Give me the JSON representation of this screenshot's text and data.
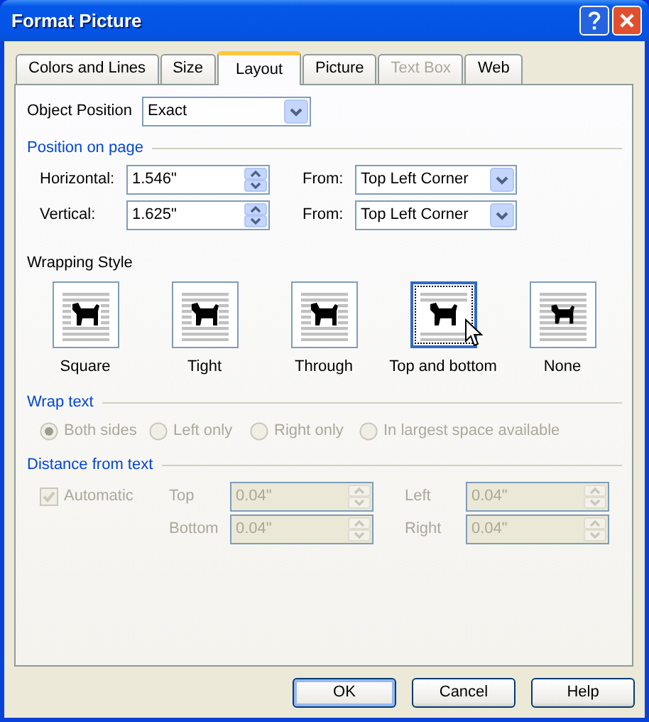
{
  "window": {
    "title": "Format Picture"
  },
  "tabs": [
    {
      "label": "Colors and Lines",
      "selected": false,
      "disabled": false
    },
    {
      "label": "Size",
      "selected": false,
      "disabled": false
    },
    {
      "label": "Layout",
      "selected": true,
      "disabled": false
    },
    {
      "label": "Picture",
      "selected": false,
      "disabled": false
    },
    {
      "label": "Text Box",
      "selected": false,
      "disabled": true
    },
    {
      "label": "Web",
      "selected": false,
      "disabled": false
    }
  ],
  "object_position": {
    "label": "Object Position",
    "value": "Exact"
  },
  "position_on_page": {
    "heading": "Position on page",
    "rows": [
      {
        "label": "Horizontal:",
        "value": "1.546\"",
        "from_label": "From:",
        "from_value": "Top Left Corner"
      },
      {
        "label": "Vertical:",
        "value": "1.625\"",
        "from_label": "From:",
        "from_value": "Top Left Corner"
      }
    ]
  },
  "wrapping_style": {
    "heading": "Wrapping Style",
    "options": [
      {
        "label": "Square",
        "kind": "square",
        "selected": false
      },
      {
        "label": "Tight",
        "kind": "tight",
        "selected": false
      },
      {
        "label": "Through",
        "kind": "through",
        "selected": false
      },
      {
        "label": "Top and bottom",
        "kind": "topbottom",
        "selected": true
      },
      {
        "label": "None",
        "kind": "none",
        "selected": false
      }
    ]
  },
  "wrap_text": {
    "heading": "Wrap text",
    "disabled": true,
    "options": [
      {
        "label": "Both sides",
        "selected": true
      },
      {
        "label": "Left only",
        "selected": false
      },
      {
        "label": "Right only",
        "selected": false
      },
      {
        "label": "In largest space available",
        "selected": false
      }
    ]
  },
  "distance_from_text": {
    "heading": "Distance from text",
    "disabled": true,
    "automatic": {
      "label": "Automatic",
      "checked": true
    },
    "fields": [
      {
        "label": "Top",
        "value": "0.04\""
      },
      {
        "label": "Left",
        "value": "0.04\""
      },
      {
        "label": "Bottom",
        "value": "0.04\""
      },
      {
        "label": "Right",
        "value": "0.04\""
      }
    ]
  },
  "buttons": [
    {
      "label": "OK",
      "default": true
    },
    {
      "label": "Cancel",
      "default": false
    },
    {
      "label": "Help",
      "default": false
    }
  ]
}
